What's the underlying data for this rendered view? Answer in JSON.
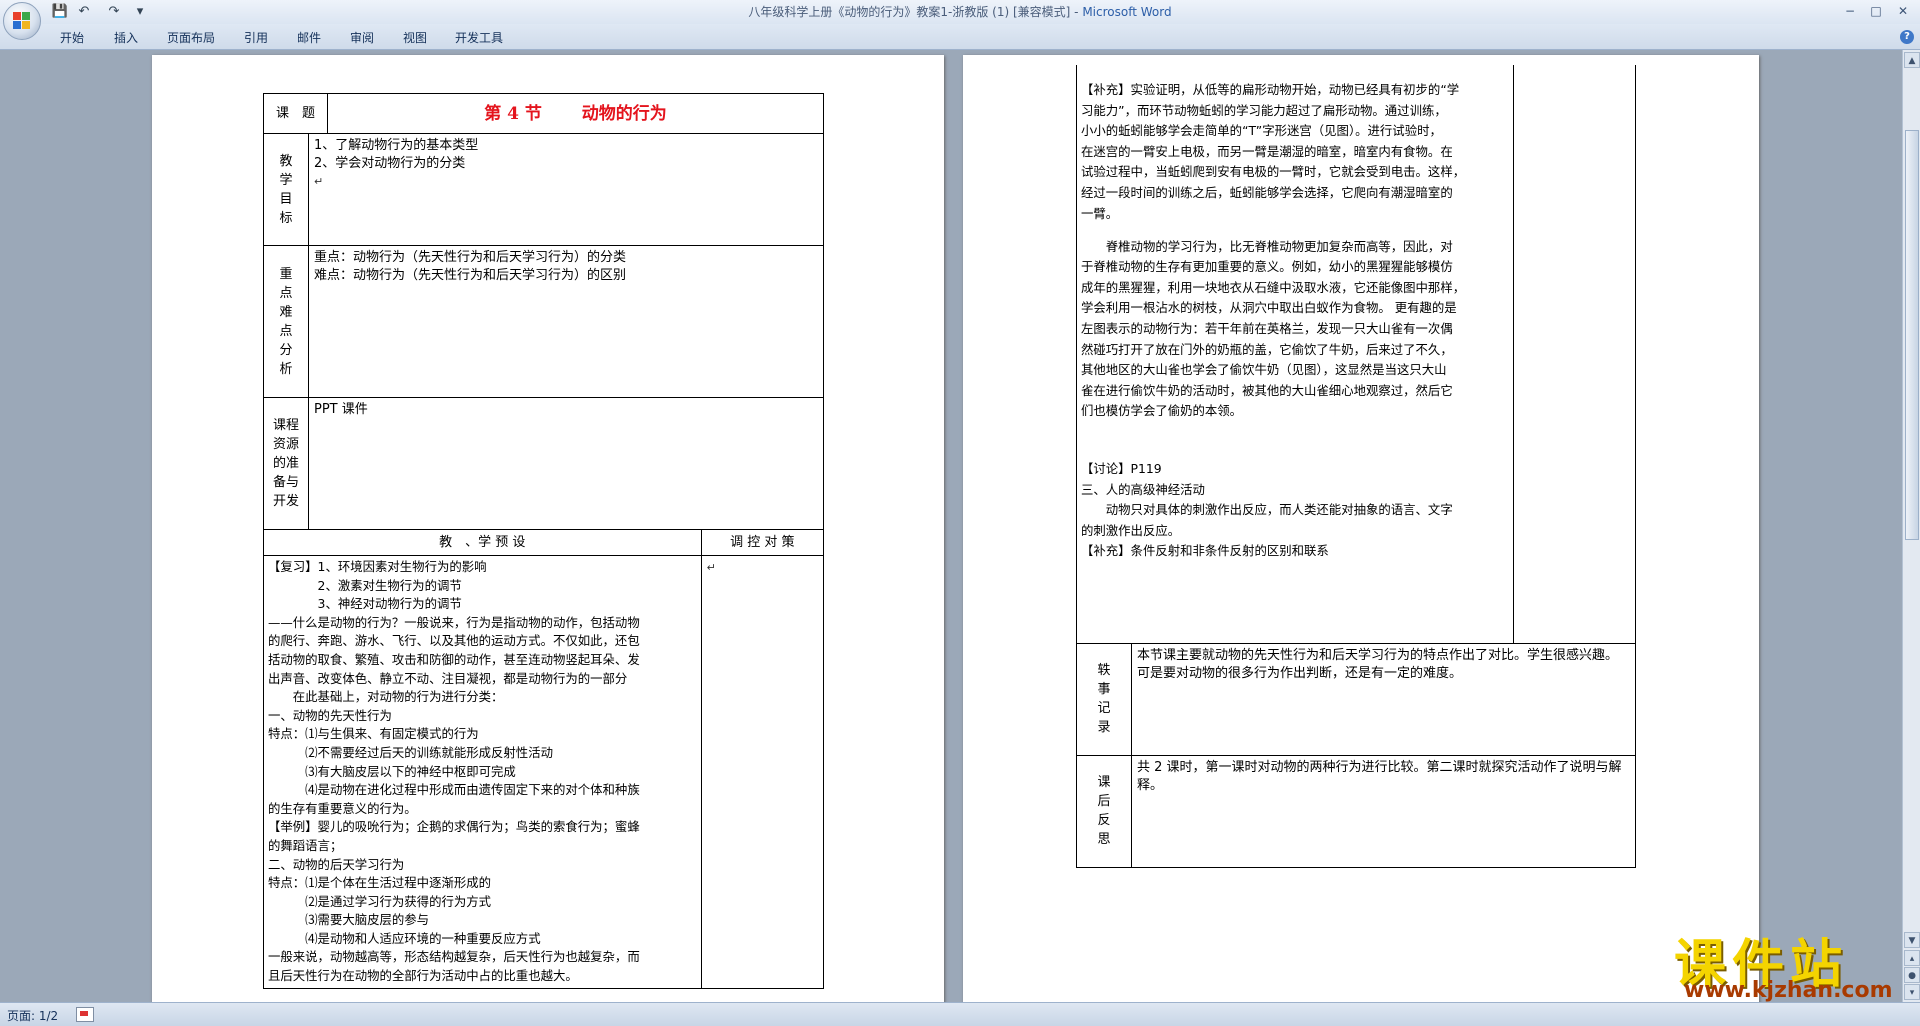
{
  "window": {
    "title": "八年级科学上册《动物的行为》教案1-浙教版 (1) [兼容模式] - ",
    "app_name": "Microsoft Word",
    "controls": [
      "−",
      "□",
      "✕"
    ]
  },
  "quick_access": {
    "save": "💾",
    "undo": "↶",
    "redo": "↷",
    "more": "▾"
  },
  "ribbon": {
    "tabs": [
      "开始",
      "插入",
      "页面布局",
      "引用",
      "邮件",
      "审阅",
      "视图",
      "开发工具"
    ],
    "help": "?"
  },
  "status_bar": {
    "page_count": "页面: 1/2"
  },
  "page1": {
    "row_topic": {
      "label": "课　题",
      "title": "第 4 节　　 动物的行为"
    },
    "row_goals": {
      "label": [
        "教",
        "学",
        "目",
        "标"
      ],
      "lines": [
        "1、了解动物行为的基本类型",
        "2、学会对动物行为的分类"
      ]
    },
    "row_keypoints": {
      "label": [
        "重",
        "点",
        "难",
        "点",
        "分",
        "析"
      ],
      "lines": [
        "重点：动物行为（先天性行为和后天学习行为）的分类",
        "难点：动物行为（先天性行为和后天学习行为）的区别"
      ]
    },
    "row_resources": {
      "label": [
        "课程",
        "资源",
        "的准",
        "备与",
        "开发"
      ],
      "content": "PPT 课件"
    },
    "header": {
      "teach_learn": "教　、学 预 设",
      "control": "调 控 对 策"
    },
    "body_lines": [
      "【复习】1、环境因素对生物行为的影响",
      "　　　　2、激素对生物行为的调节",
      "　　　　3、神经对动物行为的调节",
      "——什么是动物的行为？一般说来，行为是指动物的动作，包括动物",
      "的爬行、奔跑、游水、飞行、以及其他的运动方式。不仅如此，还包",
      "括动物的取食、繁殖、攻击和防御的动作，甚至连动物竖起耳朵、发",
      "出声音、改变体色、静立不动、注目凝视，都是动物行为的一部分",
      "　　在此基础上，对动物的行为进行分类：",
      "一、动物的先天性行为",
      "特点：⑴与生俱来、有固定模式的行为",
      "　　　⑵不需要经过后天的训练就能形成反射性活动",
      "　　　⑶有大脑皮层以下的神经中枢即可完成",
      "　　　⑷是动物在进化过程中形成而由遗传固定下来的对个体和种族",
      "的生存有重要意义的行为。",
      "【举例】婴儿的吸吮行为；企鹅的求偶行为；鸟类的索食行为；蜜蜂",
      "的舞蹈语言；",
      "二、动物的后天学习行为",
      "特点：⑴是个体在生活过程中逐渐形成的",
      "　　　⑵是通过学习行为获得的行为方式",
      "　　　⑶需要大脑皮层的参与",
      "　　　⑷是动物和人适应环境的一种重要反应方式",
      "一般来说，动物越高等，形态结构越复杂，后天性行为也越复杂，而",
      "且后天性行为在动物的全部行为活动中占的比重也越大。"
    ]
  },
  "page2": {
    "body_lines": [
      "【补充】实验证明，从低等的扁形动物开始，动物已经具有初步的“学",
      "习能力”，而环节动物蚯蚓的学习能力超过了扁形动物。通过训练，",
      "小小的蚯蚓能够学会走简单的“T”字形迷宫（见图）。进行试验时，",
      "在迷宫的一臂安上电极，而另一臂是潮湿的暗室，暗室内有食物。在",
      "试验过程中，当蚯蚓爬到安有电极的一臂时，它就会受到电击。这样，",
      "经过一段时间的训练之后，蚯蚓能够学会选择，它爬向有潮湿暗室的",
      "一臂。",
      "",
      "　　脊椎动物的学习行为，比无脊椎动物更加复杂而高等，因此，对",
      "于脊椎动物的生存有更加重要的意义。例如，幼小的黑猩猩能够模仿",
      "成年的黑猩猩，利用一块地衣从石缝中汲取水液，它还能像图中那样，",
      "学会利用一根沾水的树枝，从洞穴中取出白蚁作为食物。 更有趣的是",
      "左图表示的动物行为：若干年前在英格兰，发现一只大山雀有一次偶",
      "然碰巧打开了放在门外的奶瓶的盖，它偷饮了牛奶，后来过了不久，",
      "其他地区的大山雀也学会了偷饮牛奶（见图），这显然是当这只大山",
      "雀在进行偷饮牛奶的活动时，被其他的大山雀细心地观察过，然后它",
      "们也模仿学会了偷奶的本领。",
      "",
      "",
      "",
      "【讨论】P119",
      "三、人的高级神经活动",
      "　　动物只对具体的刺激作出反应，而人类还能对抽象的语言、文字",
      "的刺激作出反应。",
      "【补充】条件反射和非条件反射的区别和联系"
    ],
    "incident": {
      "label": [
        "轶",
        "事",
        "记",
        "录"
      ],
      "text": "本节课主要就动物的先天性行为和后天学习行为的特点作出了对比。学生很感兴趣。可是要对动物的很多行为作出判断，还是有一定的难度。"
    },
    "reflection": {
      "label": [
        "课",
        "后",
        "反",
        "思"
      ],
      "text": "共 2 课时，第一课时对动物的两种行为进行比较。第二课时就探究活动作了说明与解释。"
    }
  },
  "paragraph_mark": "↵",
  "watermark": {
    "text": "课件站",
    "url": "www.kjzhan.com"
  },
  "colors": {
    "title_red": "#e4141d",
    "app_blue": "#2c5ea8",
    "watermark_yellow": "#f4d400"
  }
}
